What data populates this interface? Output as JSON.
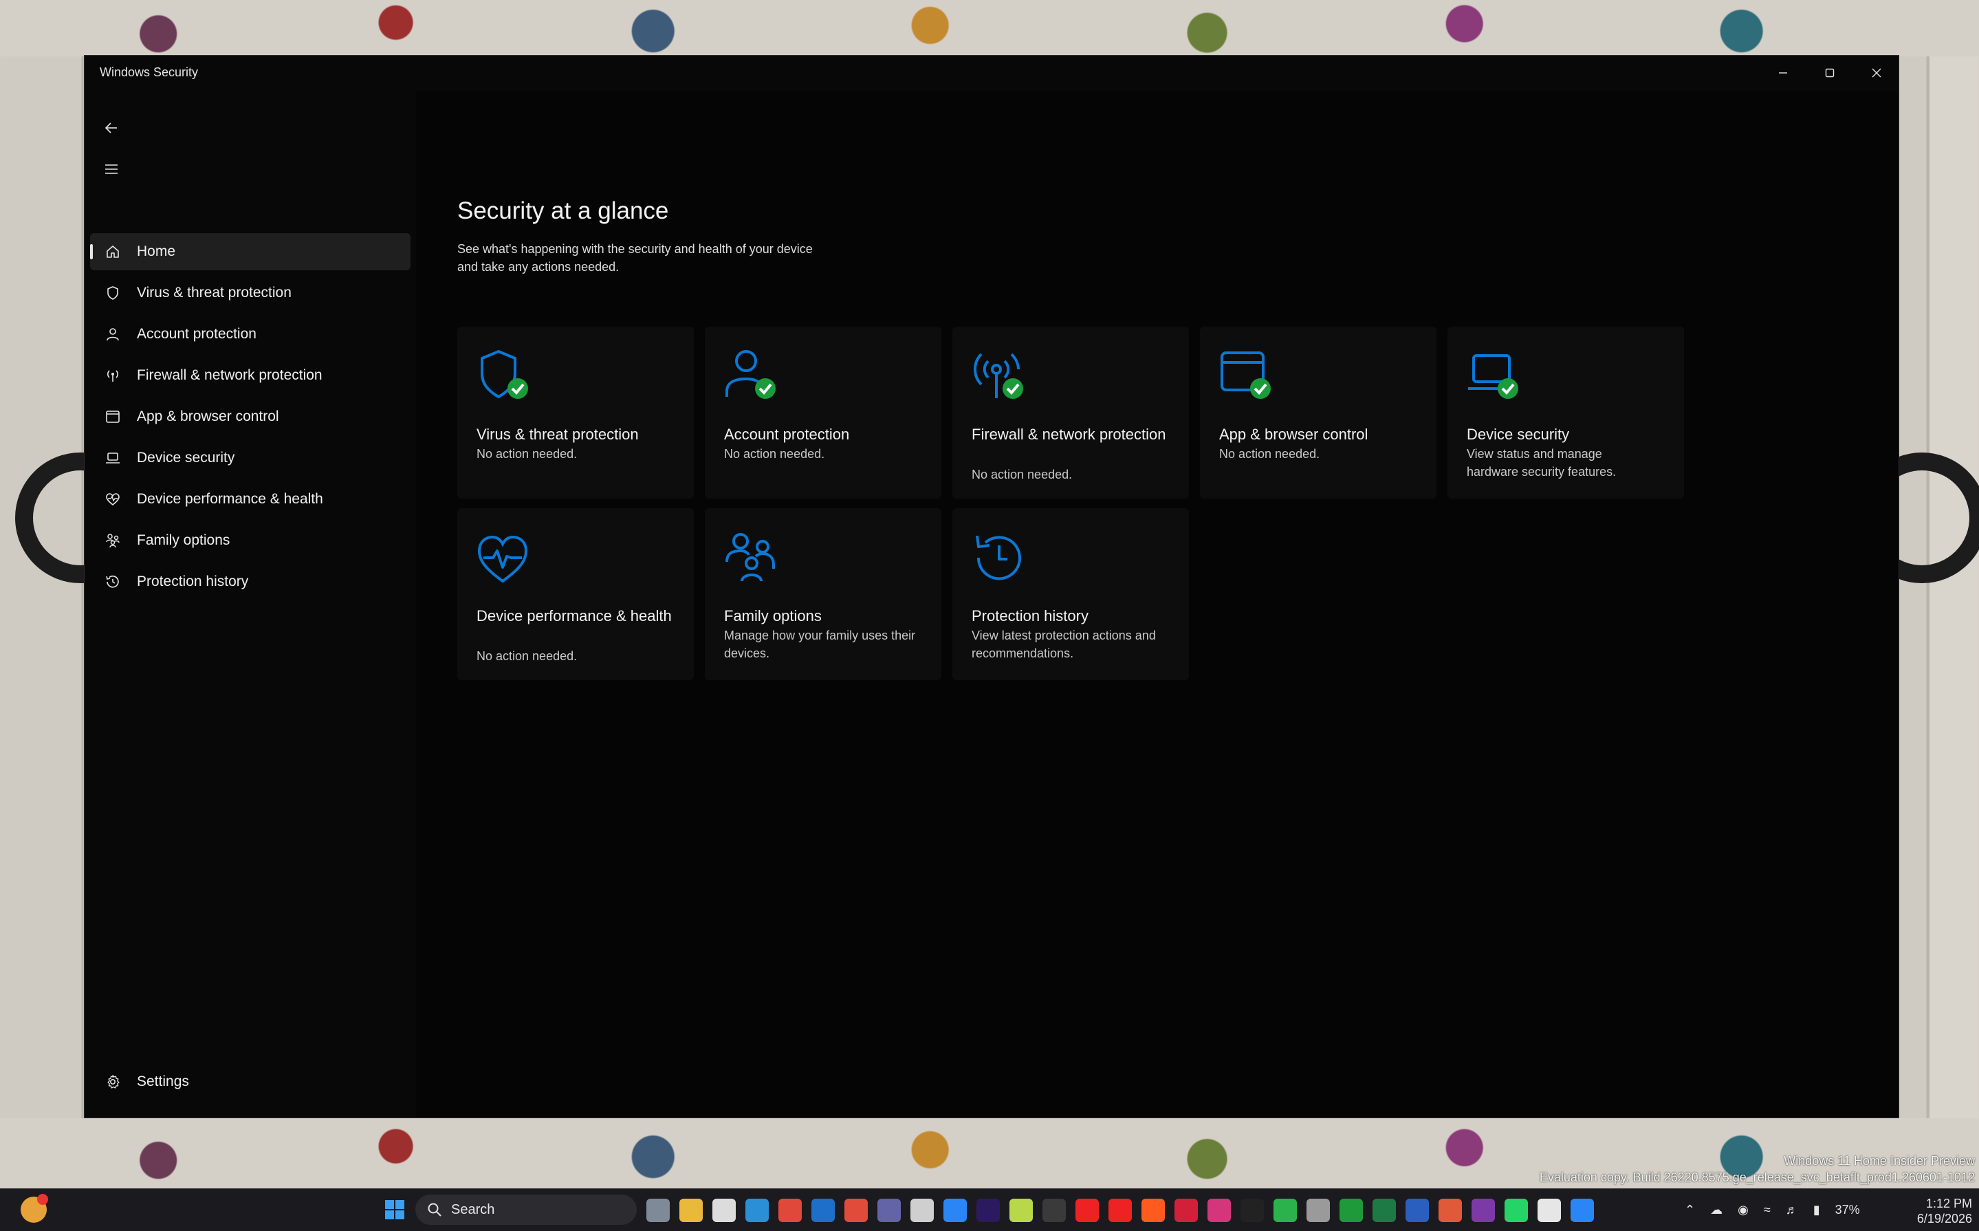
{
  "window": {
    "title": "Windows Security",
    "controls": {
      "minimize": "minimize-icon",
      "maximize": "maximize-icon",
      "close": "close-icon"
    }
  },
  "sidebar": {
    "back_icon": "back-arrow-icon",
    "menu_icon": "hamburger-icon",
    "items": [
      {
        "label": "Home",
        "icon": "home-icon",
        "active": true
      },
      {
        "label": "Virus & threat protection",
        "icon": "shield-icon"
      },
      {
        "label": "Account protection",
        "icon": "person-icon"
      },
      {
        "label": "Firewall & network protection",
        "icon": "antenna-icon"
      },
      {
        "label": "App & browser control",
        "icon": "browser-window-icon"
      },
      {
        "label": "Device security",
        "icon": "laptop-icon"
      },
      {
        "label": "Device performance & health",
        "icon": "heart-pulse-icon"
      },
      {
        "label": "Family options",
        "icon": "family-icon"
      },
      {
        "label": "Protection history",
        "icon": "history-icon"
      }
    ],
    "settings": {
      "label": "Settings",
      "icon": "gear-icon"
    }
  },
  "main": {
    "title": "Security at a glance",
    "subtitle_line1": "See what's happening with the security and health of your device",
    "subtitle_line2": "and take any actions needed.",
    "tiles": [
      {
        "title": "Virus & threat protection",
        "status": "No action needed.",
        "icon": "shield-check-icon"
      },
      {
        "title": "Account protection",
        "status": "No action needed.",
        "icon": "person-check-icon"
      },
      {
        "title": "Firewall & network protection",
        "status": "No action needed.",
        "icon": "antenna-check-icon"
      },
      {
        "title": "App & browser control",
        "status": "No action needed.",
        "icon": "browser-check-icon"
      },
      {
        "title": "Device security",
        "status": "View status and manage hardware security features.",
        "icon": "laptop-check-icon"
      },
      {
        "title": "Device performance & health",
        "status": "No action needed.",
        "icon": "heart-pulse-icon"
      },
      {
        "title": "Family options",
        "status": "Manage how your family uses their devices.",
        "icon": "family-icon"
      },
      {
        "title": "Protection history",
        "status": "View latest protection actions and recommendations.",
        "icon": "history-icon"
      }
    ]
  },
  "taskbar": {
    "search_label": "Search",
    "battery": "37%",
    "time": "1:12 PM",
    "date": "6/19/2026"
  },
  "watermark": {
    "line1": "Windows 11 Home Insider Preview",
    "line2": "Evaluation copy. Build 26220.8575.ge_release_svc_betaflt_prod1.260601-1012"
  },
  "colors": {
    "accent": "#0a78d4",
    "check": "#1a9c3a",
    "window_bg": "#080808",
    "tile_bg": "#0d0d0d"
  }
}
